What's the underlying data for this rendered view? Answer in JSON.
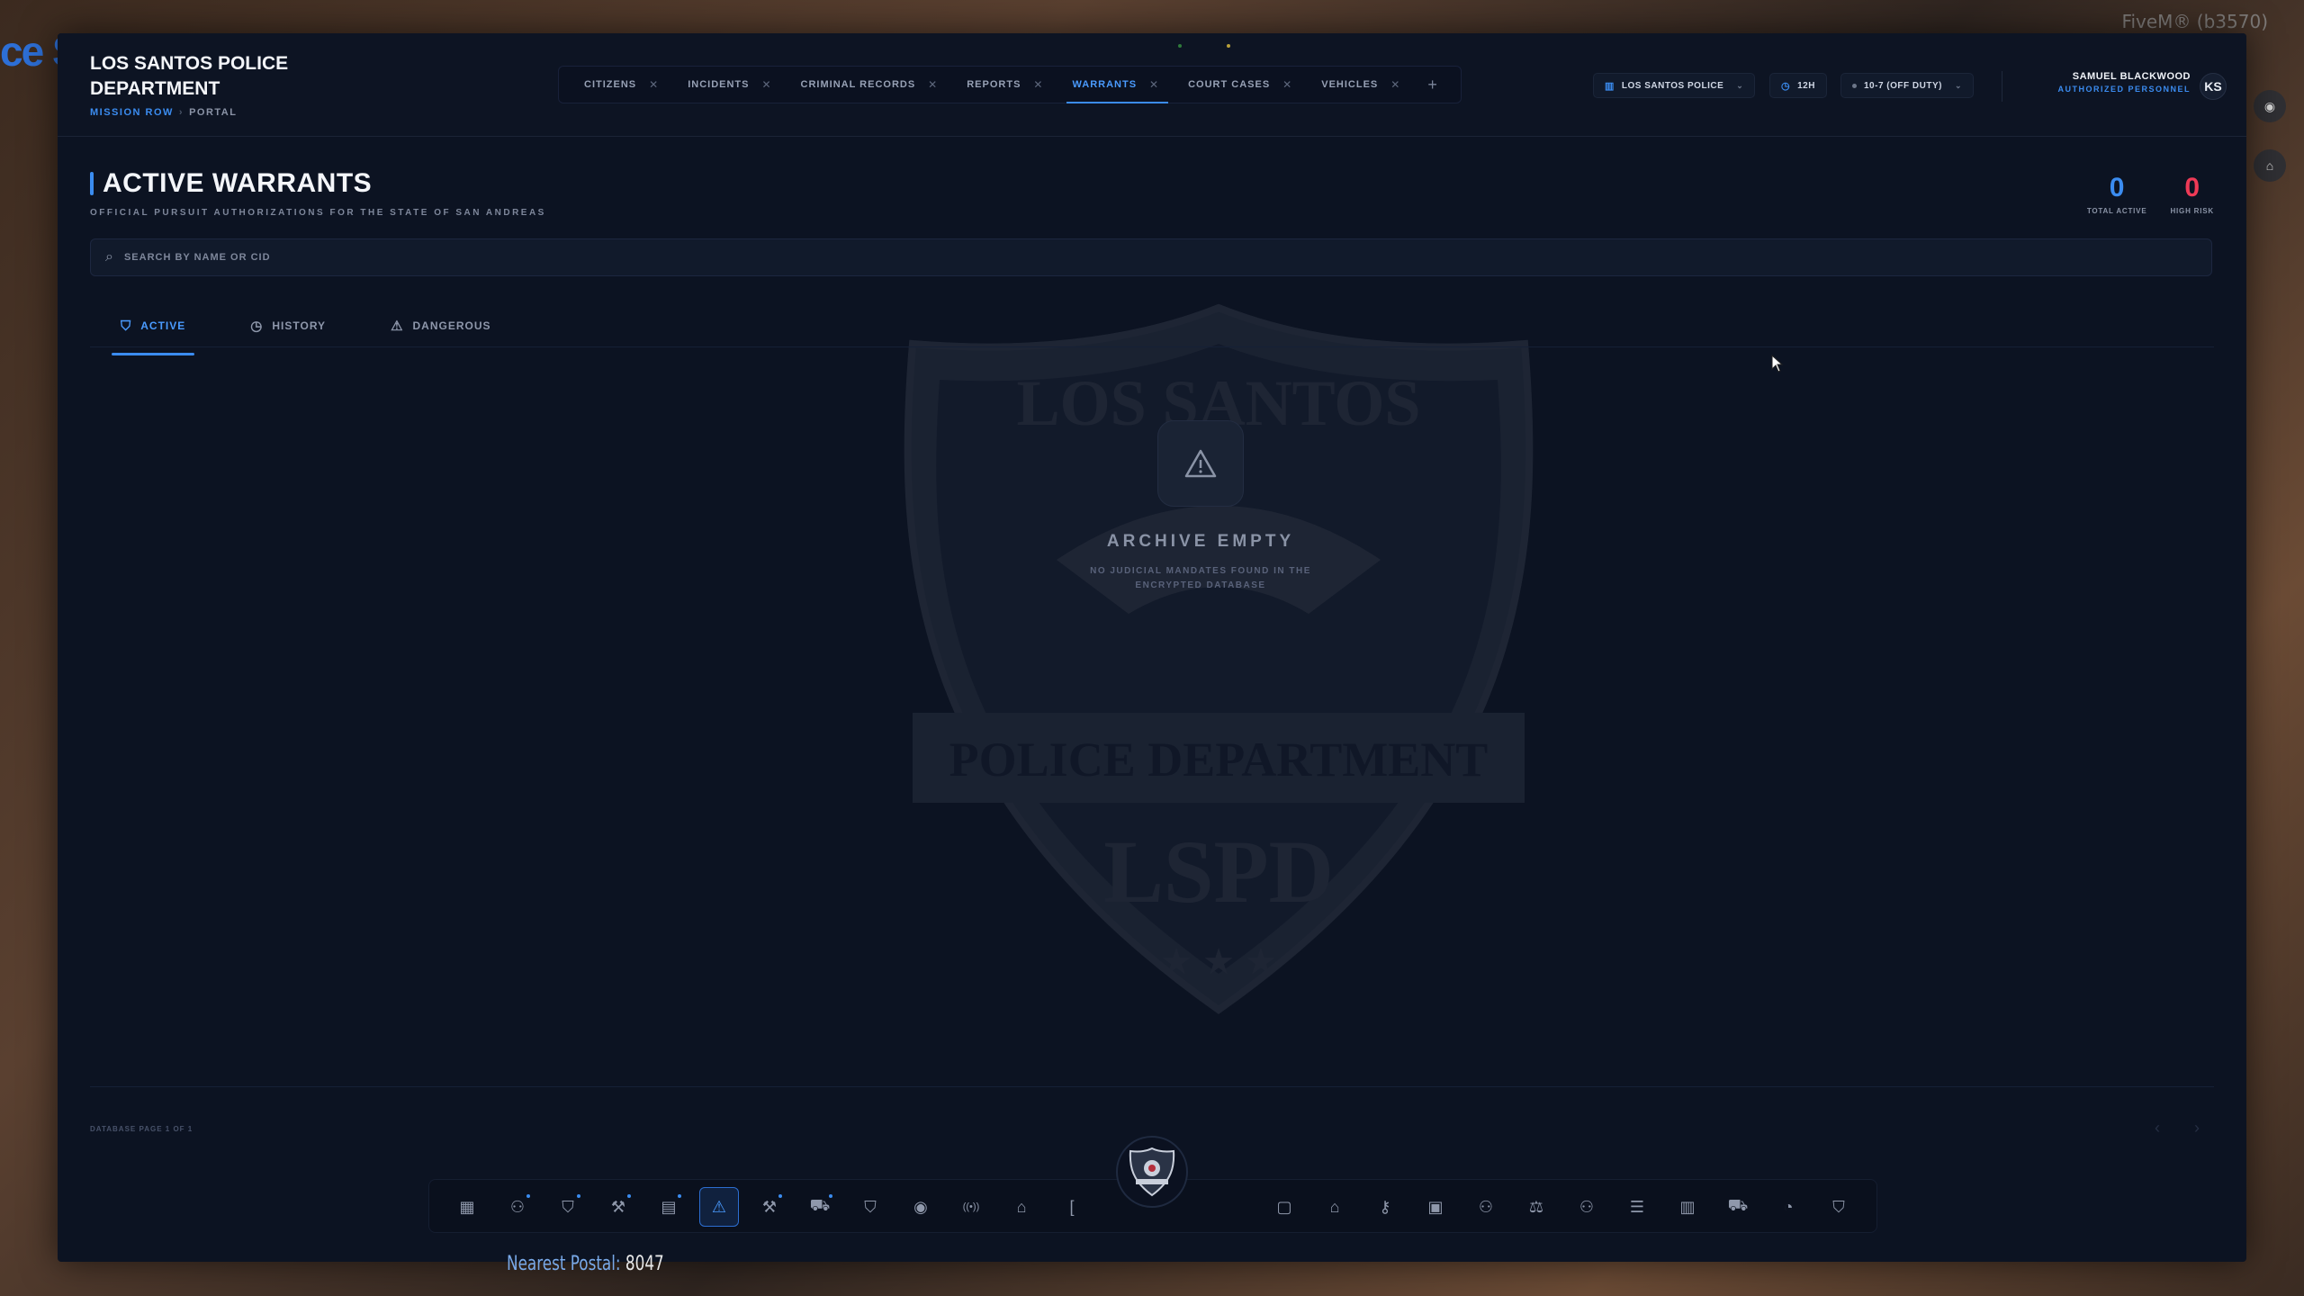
{
  "background": {
    "top_right_text": "FiveM® (b3570)",
    "postal_label": "Nearest Postal:",
    "postal_value": "8047",
    "left_sign": "ce S"
  },
  "brand": {
    "title": "LOS SANTOS POLICE DEPARTMENT",
    "location": "MISSION ROW",
    "section": "PORTAL"
  },
  "tabs": [
    {
      "label": "CITIZENS",
      "active": false
    },
    {
      "label": "INCIDENTS",
      "active": false
    },
    {
      "label": "CRIMINAL RECORDS",
      "active": false
    },
    {
      "label": "REPORTS",
      "active": false
    },
    {
      "label": "WARRANTS",
      "active": true
    },
    {
      "label": "COURT CASES",
      "active": false
    },
    {
      "label": "VEHICLES",
      "active": false
    }
  ],
  "header_controls": {
    "department": "LOS SANTOS POLICE",
    "clock_format": "12H",
    "duty_status": "10-7 (OFF DUTY)"
  },
  "user": {
    "name": "SAMUEL BLACKWOOD",
    "role": "AUTHORIZED PERSONNEL",
    "initials": "KS"
  },
  "page": {
    "title": "ACTIVE WARRANTS",
    "subtitle": "OFFICIAL PURSUIT AUTHORIZATIONS FOR THE STATE OF SAN ANDREAS"
  },
  "stats": [
    {
      "value": "0",
      "label": "TOTAL ACTIVE",
      "color": "#3b8cf0"
    },
    {
      "value": "0",
      "label": "HIGH RISK",
      "color": "#ee3a56"
    }
  ],
  "search": {
    "placeholder": "SEARCH BY NAME OR CID",
    "value": ""
  },
  "subtabs": [
    {
      "label": "ACTIVE",
      "icon": "shield-icon",
      "active": true
    },
    {
      "label": "HISTORY",
      "icon": "clock-icon",
      "active": false
    },
    {
      "label": "DANGEROUS",
      "icon": "warning-icon",
      "active": false
    }
  ],
  "watermark": {
    "top_text": "LOS SANTOS",
    "band_text": "POLICE DEPARTMENT",
    "bottom_text": "LSPD"
  },
  "empty_state": {
    "title": "ARCHIVE EMPTY",
    "message": "NO JUDICIAL MANDATES FOUND IN THE ENCRYPTED DATABASE"
  },
  "footer": {
    "page_info": "DATABASE PAGE 1 OF 1"
  },
  "dock": {
    "left": [
      {
        "icon": "dashboard-icon",
        "glyph": "▦",
        "active": false,
        "dot": false
      },
      {
        "icon": "users-icon",
        "glyph": "⚇",
        "active": false,
        "dot": true
      },
      {
        "icon": "shield-icon",
        "glyph": "⛉",
        "active": false,
        "dot": true
      },
      {
        "icon": "gavel-icon",
        "glyph": "⚒",
        "active": false,
        "dot": true
      },
      {
        "icon": "document-icon",
        "glyph": "▤",
        "active": false,
        "dot": true
      },
      {
        "icon": "warning-icon",
        "glyph": "⚠",
        "active": true,
        "dot": false
      },
      {
        "icon": "gavel-icon",
        "glyph": "⚒",
        "active": false,
        "dot": true
      },
      {
        "icon": "car-icon",
        "glyph": "⛟",
        "active": false,
        "dot": true
      },
      {
        "icon": "badge-icon",
        "glyph": "⛉",
        "active": false,
        "dot": false
      },
      {
        "icon": "camera-icon",
        "glyph": "◉",
        "active": false,
        "dot": false
      },
      {
        "icon": "radio-icon",
        "glyph": "((•))",
        "active": false,
        "dot": false
      },
      {
        "icon": "home-icon",
        "glyph": "⌂",
        "active": false,
        "dot": false
      },
      {
        "icon": "bracket-icon",
        "glyph": "[",
        "active": false,
        "dot": false
      }
    ],
    "right": [
      {
        "icon": "chat-icon",
        "glyph": "▢",
        "active": false
      },
      {
        "icon": "graduation-icon",
        "glyph": "⌂",
        "active": false
      },
      {
        "icon": "key-icon",
        "glyph": "⚷",
        "active": false
      },
      {
        "icon": "briefcase-icon",
        "glyph": "▣",
        "active": false
      },
      {
        "icon": "user-plus-icon",
        "glyph": "⚇",
        "active": false
      },
      {
        "icon": "scales-icon",
        "glyph": "⚖",
        "active": false
      },
      {
        "icon": "group-icon",
        "glyph": "⚇",
        "active": false
      },
      {
        "icon": "database-icon",
        "glyph": "☰",
        "active": false
      },
      {
        "icon": "book-icon",
        "glyph": "▥",
        "active": false
      },
      {
        "icon": "truck-icon",
        "glyph": "⛟",
        "active": false
      },
      {
        "icon": "palette-icon",
        "glyph": "◔",
        "active": false
      },
      {
        "icon": "shield-check-icon",
        "glyph": "⛉",
        "active": false
      }
    ]
  }
}
